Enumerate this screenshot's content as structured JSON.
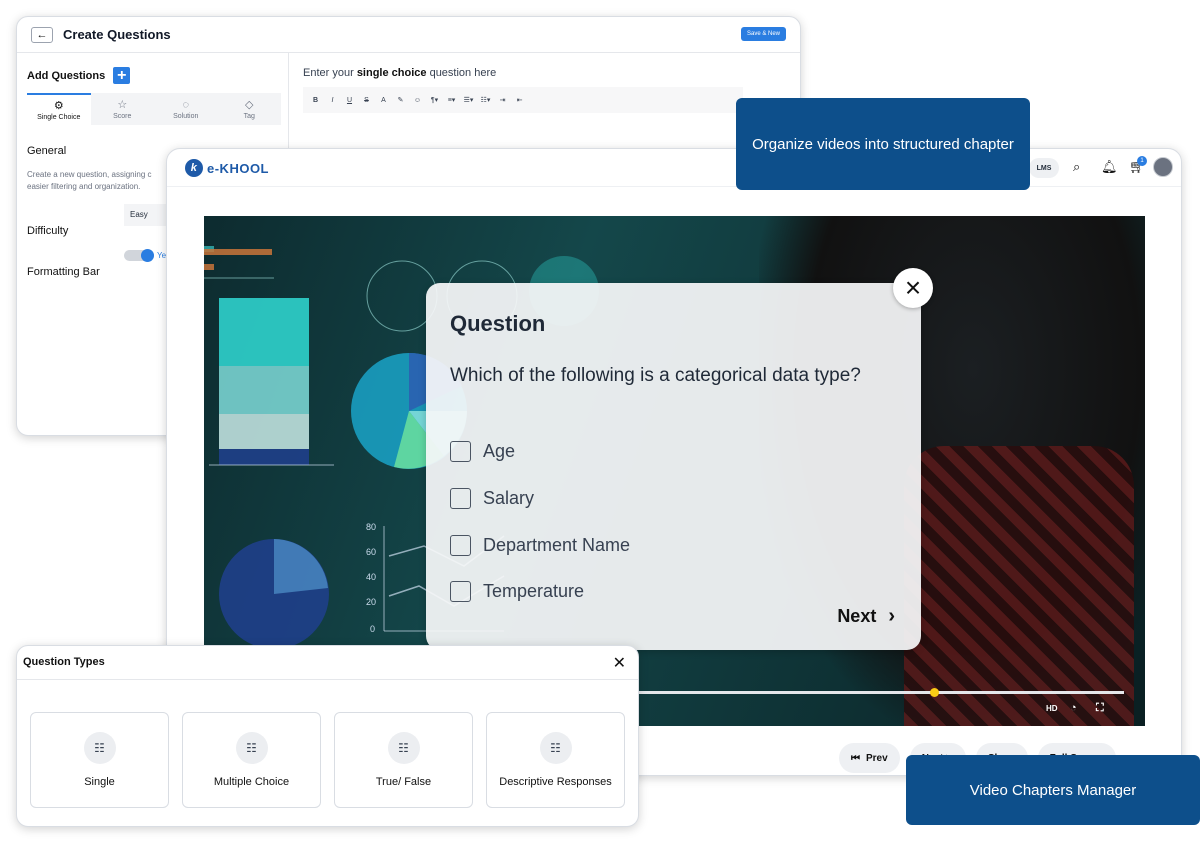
{
  "create_questions": {
    "title": "Create Questions",
    "save_new": "Save & New",
    "add_questions": "Add Questions",
    "tabs": [
      {
        "label": "Single Choice",
        "icon": "gear-icon"
      },
      {
        "label": "Score",
        "icon": "star-icon"
      },
      {
        "label": "Solution",
        "icon": "speech-bubble-icon"
      },
      {
        "label": "Tag",
        "icon": "tag-icon"
      }
    ],
    "general_heading": "General",
    "general_desc": "Create a new question, assigning c easier filtering and organization.",
    "difficulty_label": "Difficulty",
    "difficulty_value": "Easy",
    "formatting_bar_label": "Formatting Bar",
    "formatting_toggle_text": "Ye",
    "prompt_prefix": "Enter your ",
    "prompt_bold": "single choice",
    "prompt_suffix": " question here",
    "toolbar": [
      "B",
      "I",
      "U",
      "S",
      "A",
      "✎",
      "☺",
      "¶▾",
      "≡▾",
      "☰▾",
      "☷▾",
      "⇥",
      "⇤"
    ]
  },
  "lms": {
    "logo_text": "e-KHOOL",
    "lms_button": "LMS",
    "cart_count": "1",
    "video_quality": "HD",
    "bottom_buttons": [
      "Prev",
      "Next ▶",
      "Share",
      "Full Screen"
    ]
  },
  "question_modal": {
    "title": "Question",
    "text": "Which of the following is a categorical data type?",
    "options": [
      "Age",
      "Salary",
      "Department Name",
      "Temperature"
    ],
    "next_label": "Next"
  },
  "question_types": {
    "title": "Question Types",
    "types": [
      "Single",
      "Multiple Choice",
      "True/ False",
      "Descriptive Responses"
    ]
  },
  "banners": {
    "chapters": "Organize videos into structured chapter",
    "manager": "Video Chapters Manager"
  },
  "colors": {
    "accent": "#2a7de1",
    "banner": "#0d4f8b"
  }
}
